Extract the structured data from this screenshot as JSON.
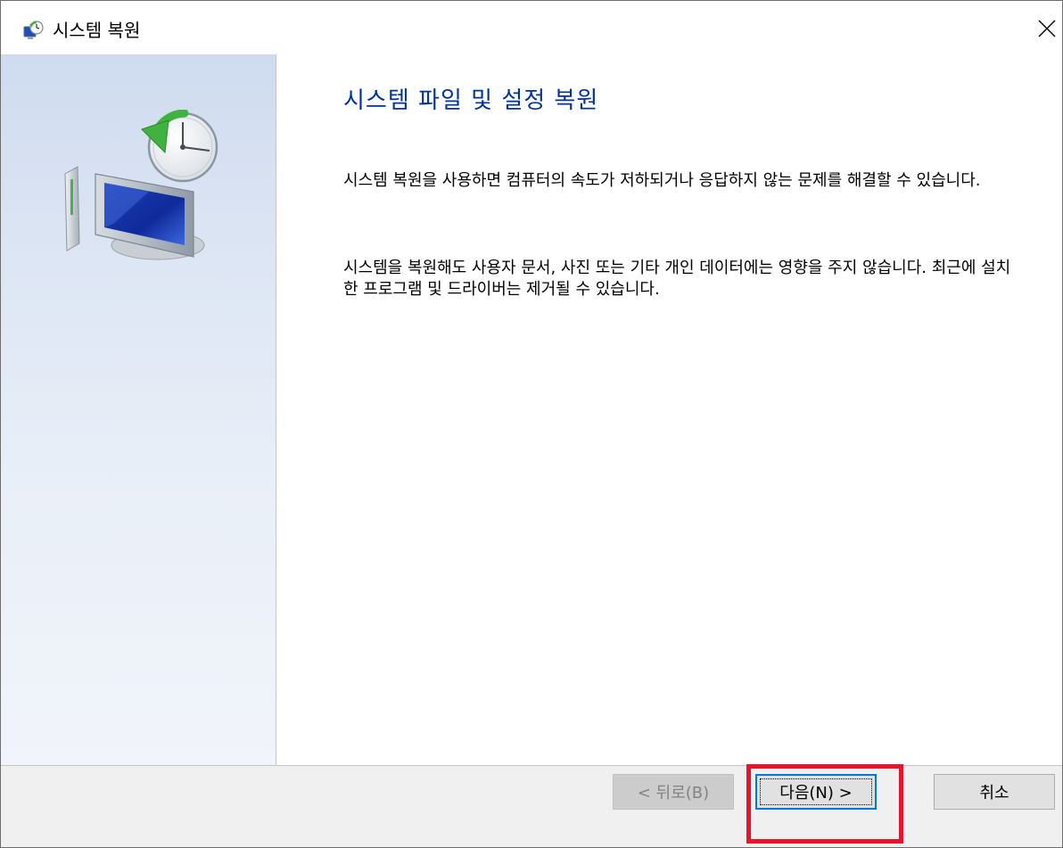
{
  "window": {
    "title": "시스템 복원"
  },
  "icons": {
    "app": "system-restore-icon",
    "close": "close-icon",
    "illustration": "system-restore-illustration"
  },
  "content": {
    "heading": "시스템 파일 및 설정 복원",
    "paragraph1": "시스템 복원을 사용하면 컴퓨터의 속도가 저하되거나 응답하지 않는 문제를 해결할 수 있습니다.",
    "paragraph2": "시스템을 복원해도 사용자 문서, 사진 또는 기타 개인 데이터에는 영향을 주지 않습니다. 최근에 설치한 프로그램 및 드라이버는 제거될 수 있습니다."
  },
  "buttons": {
    "back_label": "< 뒤로(B)",
    "back_enabled": false,
    "next_label": "다음(N) >",
    "cancel_label": "취소"
  },
  "colors": {
    "heading": "#003399",
    "highlight": "#e8142a",
    "focus_border": "#0078d7",
    "sidebar_top": "#cfdbef"
  }
}
